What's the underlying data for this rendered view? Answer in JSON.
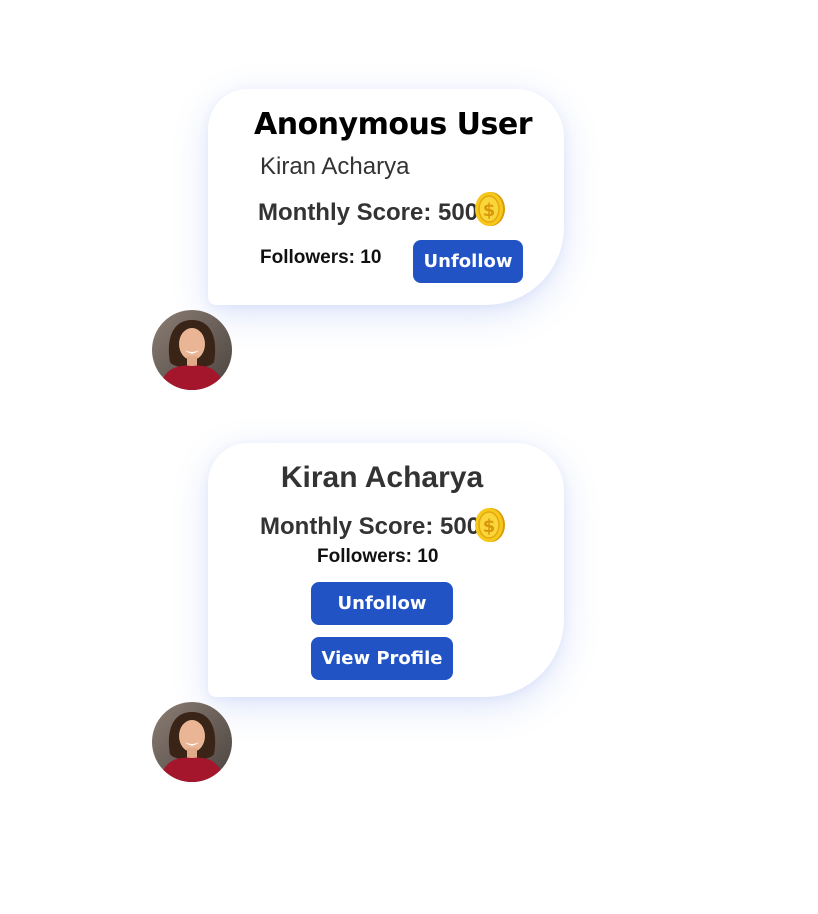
{
  "card1": {
    "title": "Anonymous User",
    "name": "Kiran Acharya",
    "score_label": "Monthly Score: 500",
    "followers_label": "Followers: 10",
    "unfollow_label": "Unfollow",
    "coin_icon": "gold-dollar-coin"
  },
  "card2": {
    "name": "Kiran Acharya",
    "score_label": "Monthly Score: 500",
    "followers_label": "Followers: 10",
    "unfollow_label": "Unfollow",
    "view_profile_label": "View Profile",
    "coin_icon": "gold-dollar-coin"
  },
  "colors": {
    "button": "#2153c4",
    "coin": "#f5c518",
    "avatar_shirt": "#a3162b"
  }
}
